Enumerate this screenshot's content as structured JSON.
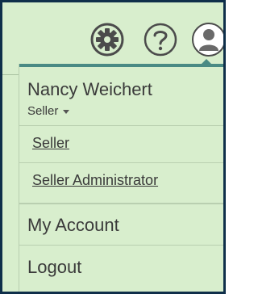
{
  "header": {
    "icons": [
      {
        "name": "settings-icon",
        "symbol": "gear"
      },
      {
        "name": "help-icon",
        "symbol": "?"
      },
      {
        "name": "user-avatar-icon",
        "symbol": "person"
      }
    ]
  },
  "user_menu": {
    "user_name": "Nancy Weichert",
    "current_role": "Seller",
    "roles": [
      {
        "label": "Seller"
      },
      {
        "label": "Seller Administrator"
      }
    ],
    "items": [
      {
        "label": "My Account"
      },
      {
        "label": "Logout"
      }
    ]
  },
  "colors": {
    "background": "#d8eecd",
    "accent": "#4a8a84",
    "icon_dark": "#4b4b4b",
    "frame": "#0f2f4a"
  }
}
